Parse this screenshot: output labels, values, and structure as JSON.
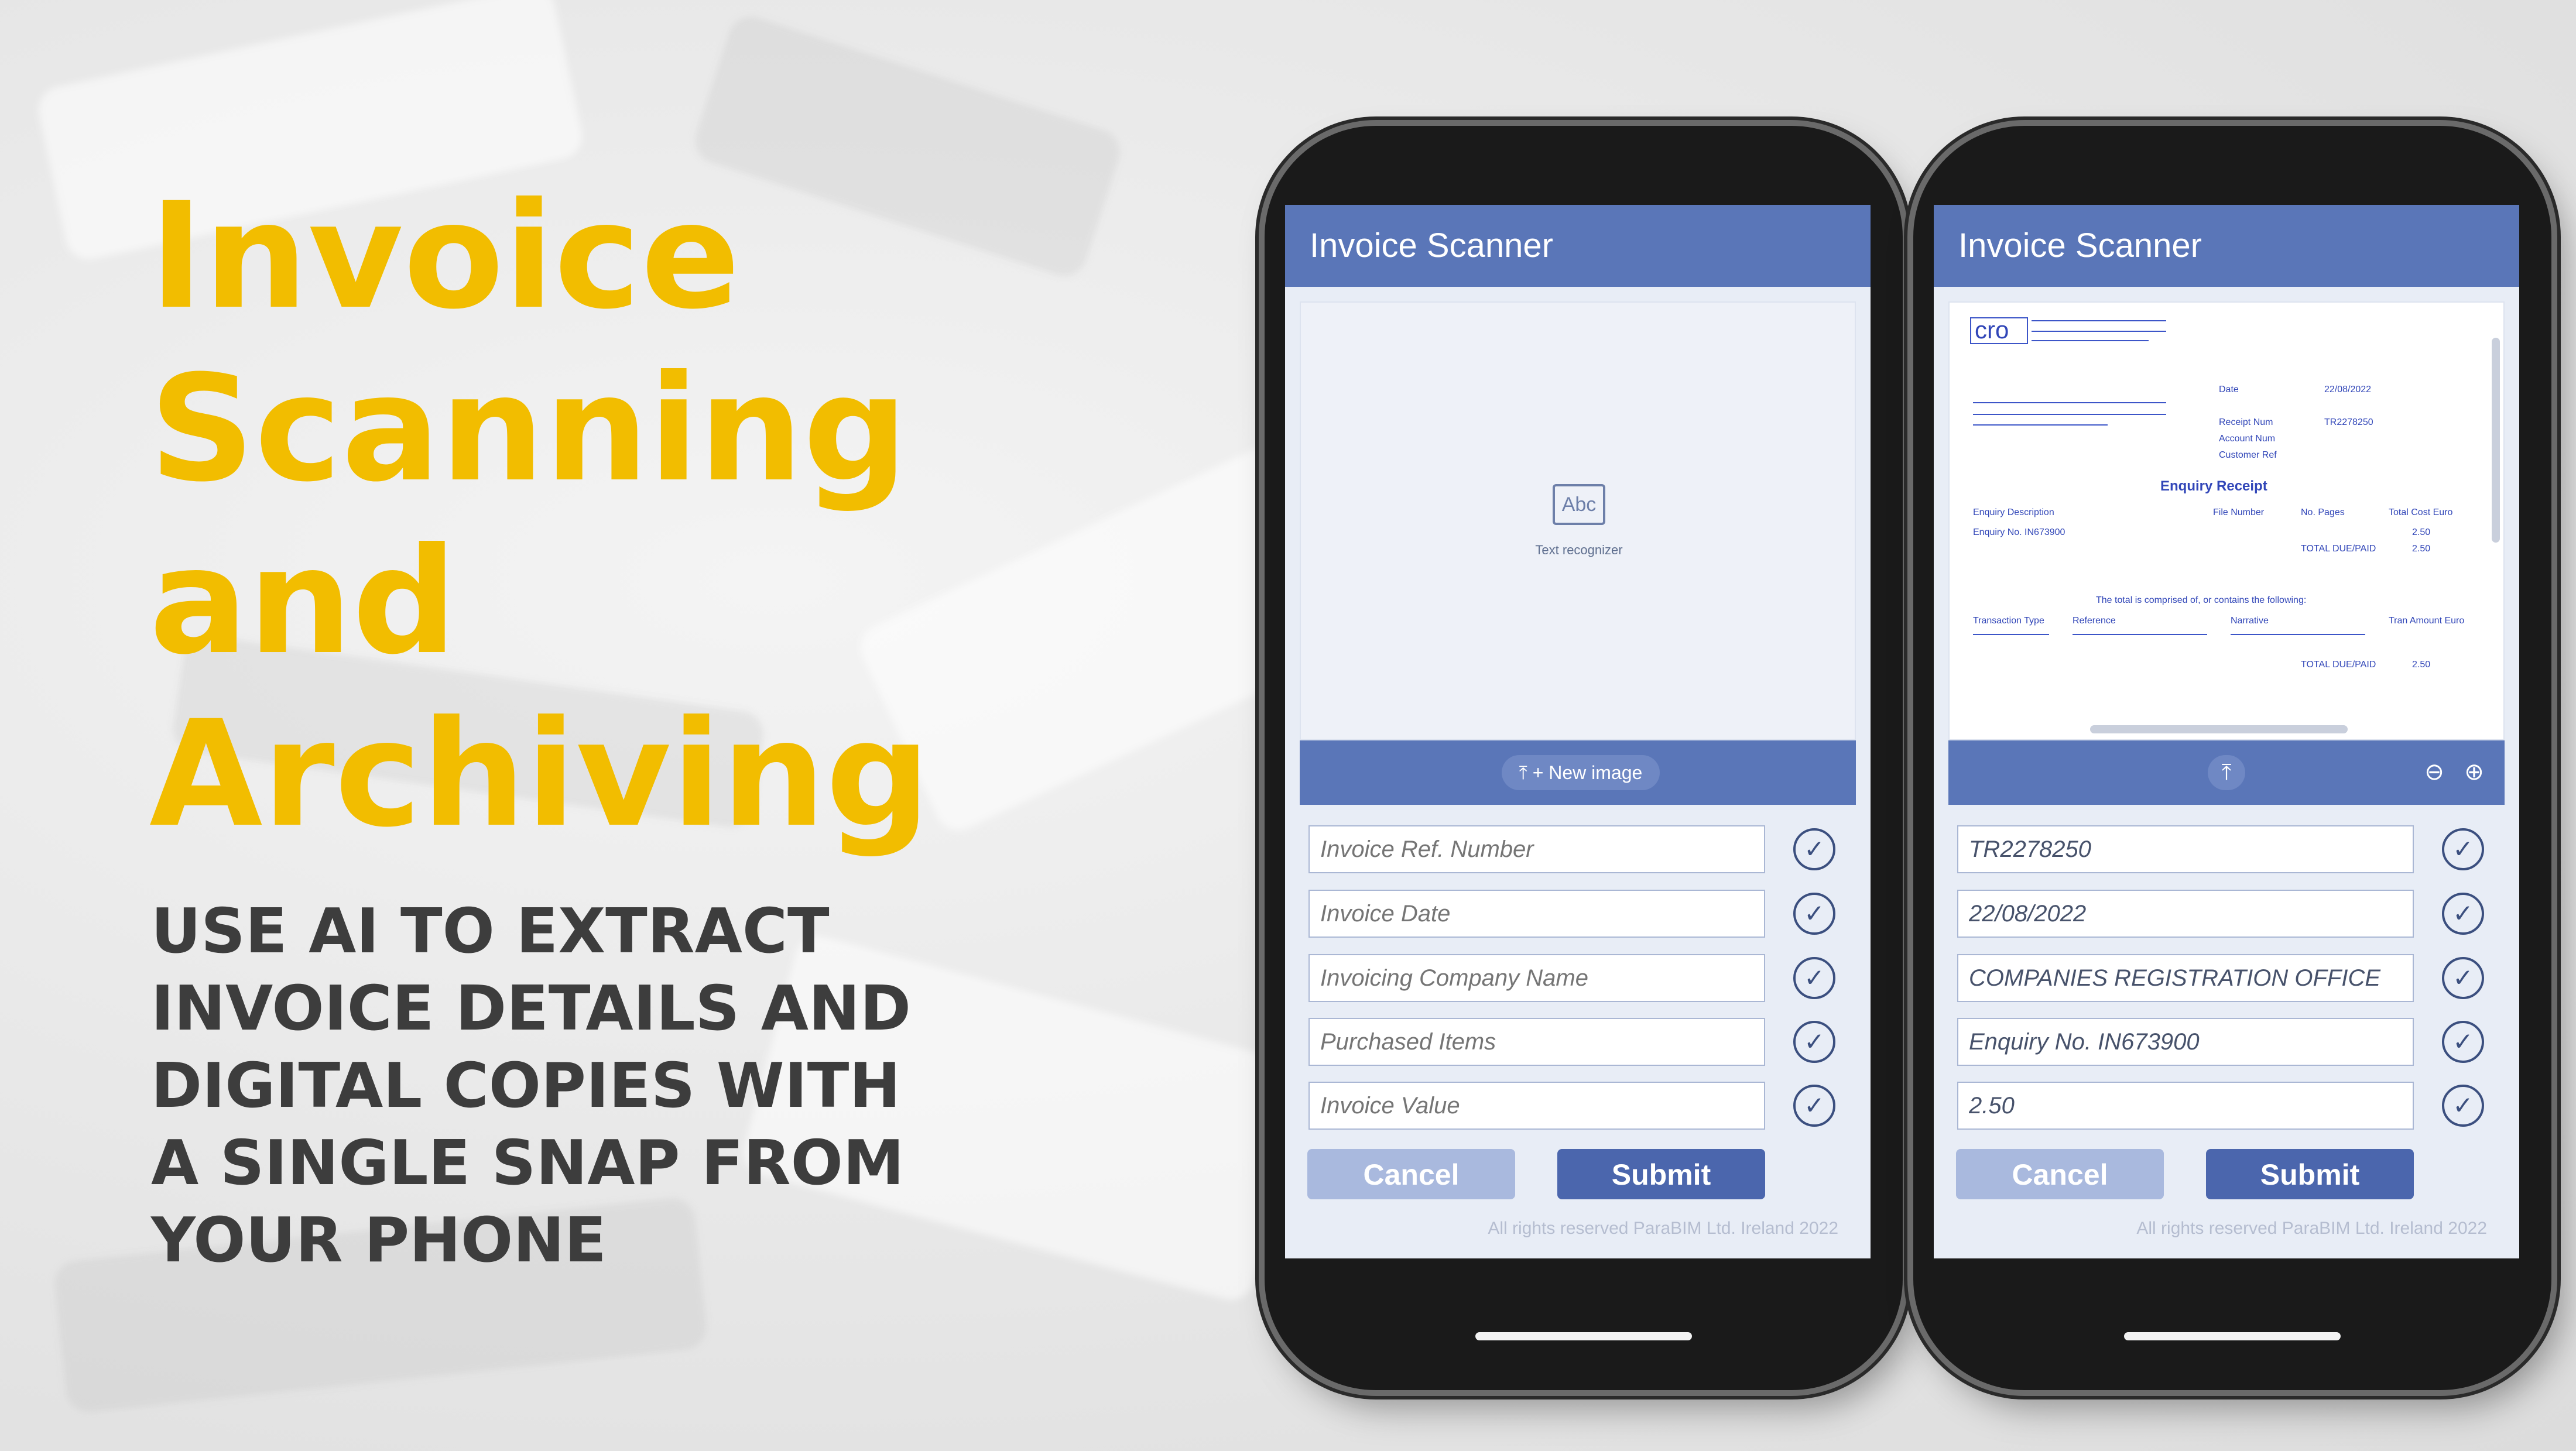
{
  "headline": [
    "Invoice",
    "Scanning and",
    "Archiving"
  ],
  "tagline": [
    "USE AI TO EXTRACT",
    "INVOICE DETAILS AND",
    "DIGITAL COPIES WITH",
    "A SINGLE SNAP FROM",
    "YOUR PHONE"
  ],
  "colors": {
    "headline": "#f2bd00",
    "tagline": "#3d3d3d",
    "appbar": "#5a76b8",
    "submit": "#4b66ad",
    "cancel": "#a9b9de"
  },
  "phone1": {
    "app_title": "Invoice Scanner",
    "recognizer_icon_text": "Abc",
    "recognizer_label": "Text recognizer",
    "new_image_label": "⤒ + New image",
    "fields": [
      {
        "placeholder": "Invoice Ref. Number",
        "value": ""
      },
      {
        "placeholder": "Invoice Date",
        "value": ""
      },
      {
        "placeholder": "Invoicing Company Name",
        "value": ""
      },
      {
        "placeholder": "Purchased Items",
        "value": ""
      },
      {
        "placeholder": "Invoice Value",
        "value": ""
      }
    ],
    "cancel_label": "Cancel",
    "submit_label": "Submit",
    "footer": "All rights reserved ParaBIM Ltd. Ireland 2022"
  },
  "phone2": {
    "app_title": "Invoice Scanner",
    "fields": [
      {
        "placeholder": "Invoice Ref. Number",
        "value": "TR2278250"
      },
      {
        "placeholder": "Invoice Date",
        "value": "22/08/2022"
      },
      {
        "placeholder": "Invoicing Company Name",
        "value": "COMPANIES REGISTRATION OFFICE"
      },
      {
        "placeholder": "Purchased Items",
        "value": "Enquiry No. IN673900"
      },
      {
        "placeholder": "Invoice Value",
        "value": "2.50"
      }
    ],
    "cancel_label": "Cancel",
    "submit_label": "Submit",
    "footer": "All rights reserved ParaBIM Ltd. Ireland 2022",
    "document": {
      "logo": "cro",
      "heading": "Enquiry Receipt",
      "labels": [
        "Date",
        "Receipt Num",
        "Account Num",
        "Customer Ref",
        "Enquiry Description",
        "Enquiry No. IN673900",
        "File Number",
        "No. Pages",
        "Total Cost Euro",
        "TOTAL DUE/PAID",
        "The total is comprised of, or contains the following:",
        "Transaction Type",
        "Reference",
        "Narrative",
        "Tran Amount Euro",
        "TOTAL DUE/PAID"
      ],
      "values": [
        "22/08/2022",
        "TR2278250",
        "2.50",
        "2.50",
        "2.50"
      ]
    }
  },
  "icons": {
    "check": "✓",
    "upload": "⤒",
    "zoom_out": "⊖",
    "zoom_in": "⊕"
  }
}
